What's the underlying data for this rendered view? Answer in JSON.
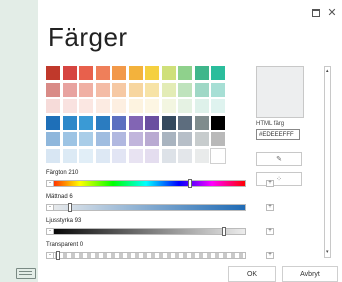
{
  "dialog": {
    "title": "Färger",
    "hue_label": "Färgton 210",
    "saturation_label": "Mättnad 6",
    "brightness_label": "Ljusstyrka 93",
    "transparency_label": "Transparent 0",
    "html_color_label": "HTML färg",
    "html_color_value": "#EDEEEFFF",
    "ok_label": "OK",
    "cancel_label": "Avbryt",
    "minus": "-",
    "plus": "+",
    "eyedropper_glyph": "✎",
    "swatch_glyph": "⁘",
    "close_glyph": "✕",
    "scroll_up_glyph": "▴",
    "scroll_down_glyph": "▾"
  },
  "preview_color": "#EDEEEF",
  "swatches": [
    [
      "#c0392b",
      "#d64541",
      "#e8604c",
      "#ef7f5a",
      "#f2994a",
      "#f3b23c",
      "#f5d040",
      "#cfe07a",
      "#8fd18c",
      "#3fb68b",
      "#2bbd9c"
    ],
    [
      "#d98b87",
      "#e8a3a0",
      "#f0b0a4",
      "#f4bca6",
      "#f6c9a4",
      "#f7d6a0",
      "#f7e3a6",
      "#e3ecb6",
      "#bfe3bd",
      "#9fd8c6",
      "#a7dfd5"
    ],
    [
      "#f6dbd9",
      "#f9e2e0",
      "#fbe7e2",
      "#fcebe2",
      "#fdefe1",
      "#fdf3e0",
      "#fdf6e3",
      "#f3f6e1",
      "#e5f2e3",
      "#def1ea",
      "#dff3ef"
    ],
    [
      "#1e6fb8",
      "#2d88c9",
      "#3a9ad5",
      "#2b7cc0",
      "#5c6fc0",
      "#8265b4",
      "#6a4ea0",
      "#34495e",
      "#5d6d7e",
      "#7f8c8d",
      "#000000"
    ],
    [
      "#8fb7dc",
      "#9dc4e4",
      "#a9cde8",
      "#a0bde0",
      "#b1b8e0",
      "#c1b5dc",
      "#b9aad2",
      "#a9b4c0",
      "#b7bfc8",
      "#c7cccd",
      "#b9b9b9"
    ],
    [
      "#d8e6f3",
      "#dceaf5",
      "#e1eef7",
      "#dde8f4",
      "#e2e5f4",
      "#e8e3f2",
      "#e4ddef",
      "#dde2e8",
      "#e3e6ea",
      "#e9ebeb",
      "#ffffff"
    ]
  ]
}
